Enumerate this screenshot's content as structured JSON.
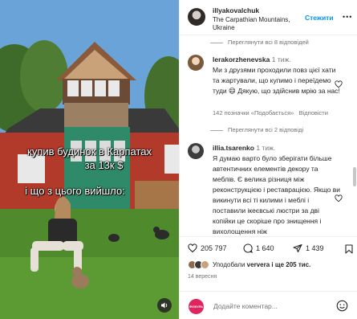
{
  "post": {
    "caption_lines": [
      "купив будинок в Карпатах",
      "за 13к $",
      "і що з цього вийшло:"
    ]
  },
  "header": {
    "username": "illyakovalchuk",
    "location": "The Carpathian Mountains, Ukraine",
    "follow_label": "Стежити",
    "more_label": "•••"
  },
  "comments": {
    "view_replies_top": "Переглянути всі 8 відповідей",
    "items": [
      {
        "username": "lerakorzhenevska",
        "time": "1 тиж.",
        "text": "Ми з друзями проходили повз цієї хати та жартували, що купимо і переїдемо туди 😄 Дякую, що здійснив мрію за нас!",
        "likes": "142 позначки «Подобається»",
        "reply_label": "Відповісти",
        "view_replies": "Переглянути всі 2 відповіді"
      },
      {
        "username": "illia.tsarenko",
        "time": "1 тиж.",
        "text": "Я думаю варто було зберігати більше автентичних елементів декору та меблів. Є велика різниця між реконструкцією і реставрацією. Якщо ви викинути всі ті килими і меблі і поставили ікеєвські люстри за дві копійки це скоріше про знищення і вихолощення ніж"
      }
    ]
  },
  "actions": {
    "likes_count": "205 797",
    "comments_count": "1 640",
    "shares_count": "1 439"
  },
  "likes_summary": {
    "prefix": "Уподобали",
    "user": "ververa",
    "suffix": "і ще 205 тис."
  },
  "date": "14 вересня",
  "add_comment": {
    "avatar_text": "ФІЗКУЛЬ",
    "placeholder": "Додайте коментар..."
  },
  "colors": {
    "accent": "#0095f6",
    "text": "#262626",
    "muted": "#737373"
  }
}
